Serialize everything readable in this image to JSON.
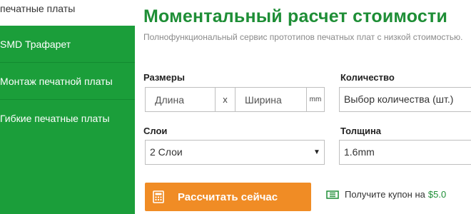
{
  "sidebar": {
    "top_item": "печатные платы",
    "items": [
      {
        "label": "SMD Трафарет"
      },
      {
        "label": "Монтаж печатной платы"
      },
      {
        "label": "Гибкие печатные платы"
      }
    ]
  },
  "main": {
    "title": "Моментальный расчет стоимости",
    "subtitle": "Полнофункциональный сервис прототипов печатных плат с низкой стоимостью.",
    "size": {
      "label": "Размеры",
      "length_placeholder": "Длина",
      "separator": "x",
      "width_placeholder": "Ширина",
      "unit": "mm"
    },
    "quantity": {
      "label": "Количество",
      "value": "Выбор количества (шт.)"
    },
    "layers": {
      "label": "Слои",
      "value": "2 Слои",
      "arrow": "▼"
    },
    "thickness": {
      "label": "Толщина",
      "value": "1.6mm"
    },
    "calculate_button": "Рассчитать сейчас",
    "coupon": {
      "text": "Получите купон на",
      "amount": "$5.0"
    }
  },
  "colors": {
    "brand_green": "#1e8e36",
    "sidebar_green": "#1b9e3a",
    "button_orange": "#f08c25"
  },
  "icons": {
    "button": "calculator-icon",
    "coupon": "ticket-icon"
  }
}
